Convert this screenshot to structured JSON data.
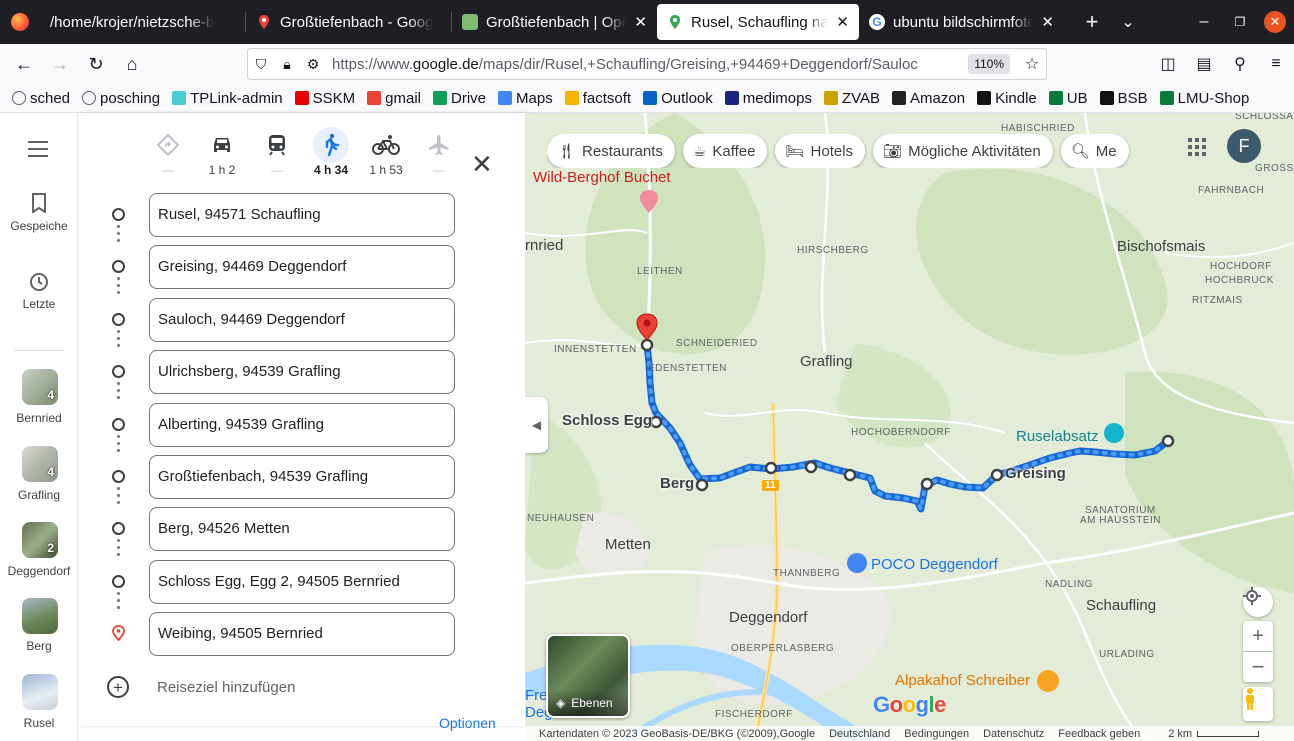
{
  "browser": {
    "tabs": [
      {
        "title": "/home/krojer/nietzsche-b",
        "icon": "document-icon",
        "active": false
      },
      {
        "title": "Großtiefenbach - Goog",
        "icon": "maps-pin-icon",
        "active": false
      },
      {
        "title": "Großtiefenbach | Oper",
        "icon": "osm-icon",
        "active": false
      },
      {
        "title": "Rusel, Schaufling nach",
        "icon": "maps-pin-icon",
        "active": true
      },
      {
        "title": "ubuntu bildschirmfoto",
        "icon": "google-g-icon",
        "active": false
      }
    ],
    "new_tab": "+",
    "url": {
      "prefix": "https://www.",
      "domain": "google.de",
      "path": "/maps/dir/Rusel,+Schaufling/Greising,+94469+Deggendorf/Sauloc"
    },
    "zoom": "110%",
    "bookmarks": [
      {
        "label": "sched",
        "icon": "globe-icon",
        "color": "#5f6368"
      },
      {
        "label": "posching",
        "icon": "globe-icon",
        "color": "#5f6368"
      },
      {
        "label": "TPLink-admin",
        "icon": "tplink-icon",
        "color": "#4acbd6"
      },
      {
        "label": "SSKM",
        "icon": "sparkasse-icon",
        "color": "#e60000"
      },
      {
        "label": "gmail",
        "icon": "gmail-icon",
        "color": "#ea4335"
      },
      {
        "label": "Drive",
        "icon": "drive-icon",
        "color": "#0f9d58"
      },
      {
        "label": "Maps",
        "icon": "google-g-icon",
        "color": "#4285f4"
      },
      {
        "label": "factsoft",
        "icon": "factsoft-icon",
        "color": "#f4b400"
      },
      {
        "label": "Outlook",
        "icon": "outlook-icon",
        "color": "#0a64c8"
      },
      {
        "label": "medimops",
        "icon": "medimops-icon",
        "color": "#1a237e"
      },
      {
        "label": "ZVAB",
        "icon": "zvab-icon",
        "color": "#c9a400"
      },
      {
        "label": "Amazon",
        "icon": "amazon-icon",
        "color": "#222"
      },
      {
        "label": "Kindle",
        "icon": "kindle-icon",
        "color": "#111"
      },
      {
        "label": "UB",
        "icon": "lmu-icon",
        "color": "#0a7a3a"
      },
      {
        "label": "BSB",
        "icon": "bsb-icon",
        "color": "#111"
      },
      {
        "label": "LMU-Shop",
        "icon": "lmu-icon",
        "color": "#0a7a3a"
      }
    ]
  },
  "rail": {
    "saved_label": "Gespeiche",
    "recent_label": "Letzte",
    "items": [
      {
        "label": "Bernried",
        "count": "4"
      },
      {
        "label": "Grafling",
        "count": "4"
      },
      {
        "label": "Deggendorf",
        "count": "2"
      },
      {
        "label": "Berg",
        "count": ""
      },
      {
        "label": "Rusel",
        "count": ""
      }
    ]
  },
  "directions": {
    "modes": [
      {
        "name": "best",
        "icon": "directions-icon",
        "time": "—"
      },
      {
        "name": "car",
        "icon": "car-icon",
        "time": "1 h 2"
      },
      {
        "name": "transit",
        "icon": "train-icon",
        "time": "—"
      },
      {
        "name": "walk",
        "icon": "walk-icon",
        "time": "4 h 34"
      },
      {
        "name": "bike",
        "icon": "bike-icon",
        "time": "1 h 53"
      },
      {
        "name": "flight",
        "icon": "plane-icon",
        "time": "—"
      }
    ],
    "stops": [
      "Rusel, 94571 Schaufling",
      "Greising, 94469 Deggendorf",
      "Sauloch, 94469 Deggendorf",
      "Ulrichsberg, 94539 Grafling",
      "Alberting, 94539 Grafling",
      "Großtiefenbach, 94539 Grafling",
      "Berg, 94526 Metten",
      "Schloss Egg, Egg 2, 94505 Bernried",
      "Weibing, 94505 Bernried"
    ],
    "add_destination": "Reiseziel hinzufügen",
    "options_peek": "Optionen"
  },
  "map": {
    "chips": [
      {
        "label": "Restaurants",
        "icon": "fork-knife-icon"
      },
      {
        "label": "Kaffee",
        "icon": "coffee-icon"
      },
      {
        "label": "Hotels",
        "icon": "bed-icon"
      },
      {
        "label": "Mögliche Aktivitäten",
        "icon": "camera-icon"
      },
      {
        "label": "Me",
        "icon": "search-icon"
      }
    ],
    "avatar_letter": "F",
    "labels": {
      "habischried": "HABISCHRIED",
      "schlossau": "SCHLOSSAU",
      "grossseiboldsried": "GROSSEI",
      "fahrnbach": "FAHRNBACH",
      "bernried": "rnried",
      "hirschberg": "HIRSCHBERG",
      "bischofsmais": "Bischofsmais",
      "leithen": "LEITHEN",
      "hochdorf": "HOCHDORF",
      "hochbruck": "HOCHBRUCK",
      "ritzmais": "RITZMAIS",
      "innenstetten": "INNENSTETTEN",
      "schneideried": "SCHNEIDERIED",
      "edenstetten": "EDENSTETTEN",
      "grafling": "Grafling",
      "schloss_egg": "Schloss Egg",
      "hochoberndorf": "HOCHOBERNDORF",
      "ruselabsatz": "Ruselabsatz",
      "greising": "Greising",
      "berg": "Berg",
      "road_11": "11",
      "neuhausen": "NEUHAUSEN",
      "sanatorium1": "SANATORIUM",
      "sanatorium2": "AM HAUSSTEIN",
      "metten": "Metten",
      "poco": "POCO Deggendorf",
      "thannberg": "THANNBERG",
      "nadling": "NADLING",
      "schaufling": "Schaufling",
      "deggendorf": "Deggendorf",
      "oberperlasberg": "OBERPERLASBERG",
      "urlading": "URLADING",
      "alpakahof": "Alpakahof Schreiber",
      "fischerdorf": "FISCHERDORF",
      "wild_berghof": "Wild-Berghof Buchet",
      "frei": "Frei",
      "deg": "Deg"
    },
    "layers_label": "Ebenen",
    "footer": {
      "data": "Kartendaten © 2023 GeoBasis-DE/BKG (©2009),Google",
      "country": "Deutschland",
      "terms": "Bedingungen",
      "privacy": "Datenschutz",
      "feedback": "Feedback geben",
      "scale": "2 km"
    }
  }
}
